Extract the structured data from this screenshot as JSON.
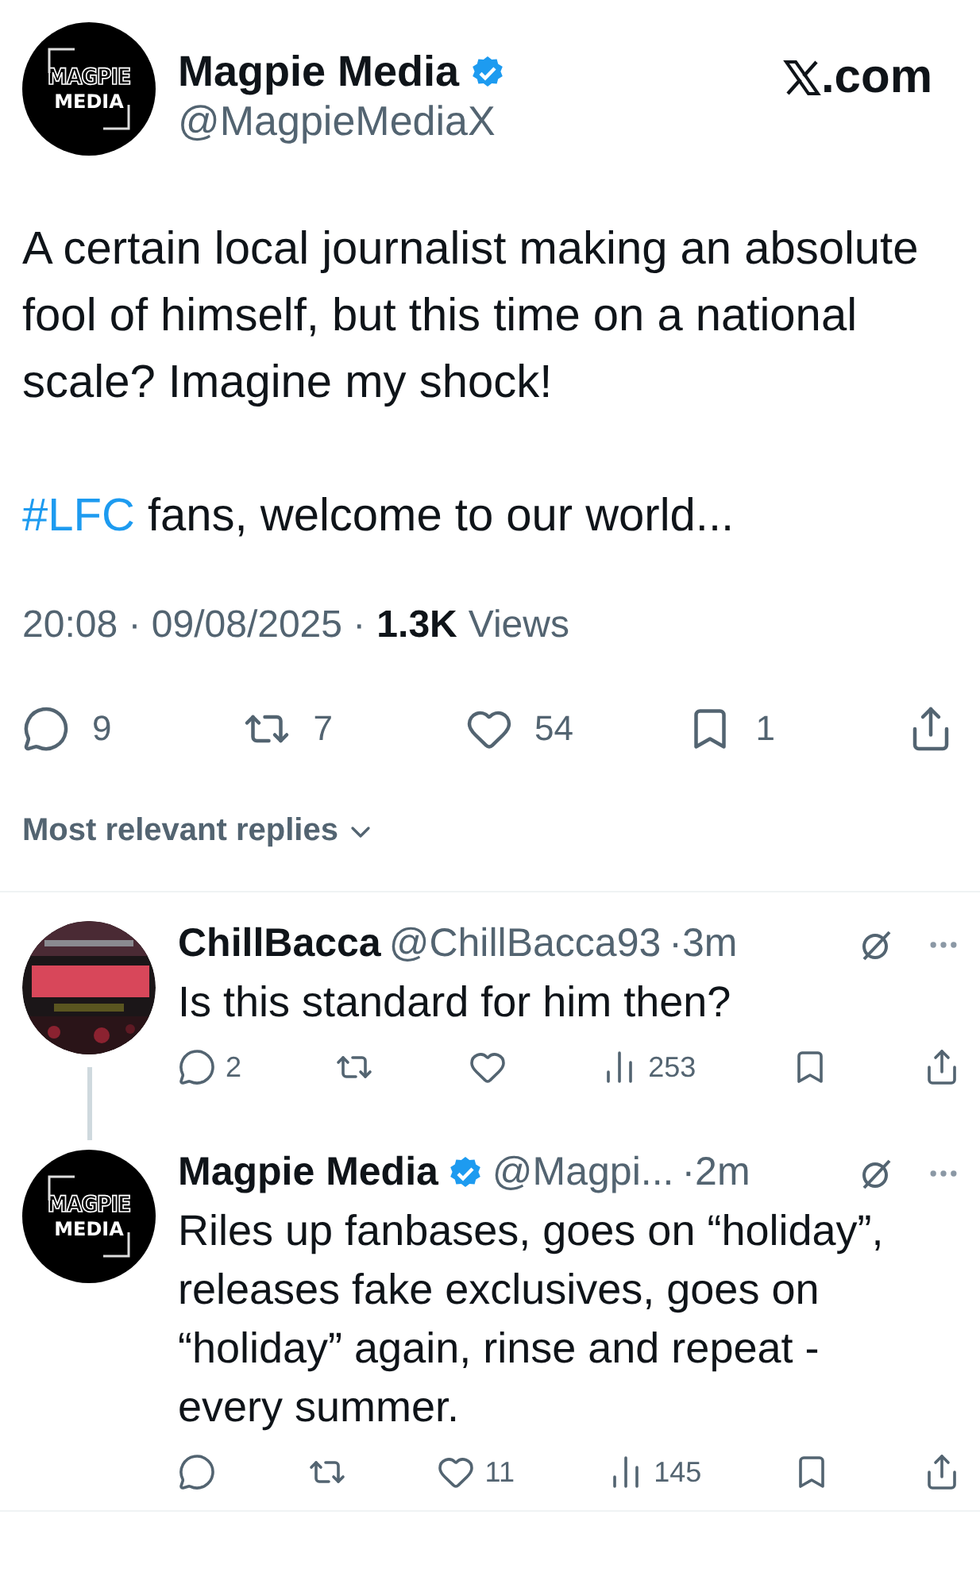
{
  "post": {
    "author": {
      "name": "Magpie Media",
      "handle": "@MagpieMediaX",
      "verified": true,
      "logo_top": "MAGPIE",
      "logo_bottom": "MEDIA"
    },
    "site": ".com",
    "paragraphs": [
      {
        "segments": [
          {
            "kind": "text",
            "text": "A certain local journalist making an absolute fool of himself, but this time on a national scale? Imagine my shock!"
          }
        ]
      },
      {
        "segments": [
          {
            "kind": "hashtag",
            "text": "#LFC"
          },
          {
            "kind": "text",
            "text": " fans, welcome to our world..."
          }
        ]
      }
    ],
    "timestamp": "20:08 · 09/08/2025 ·",
    "views_count": "1.3K",
    "views_label": "Views",
    "actions": [
      {
        "kind": "reply",
        "count": "9"
      },
      {
        "kind": "repost",
        "count": "7"
      },
      {
        "kind": "like",
        "count": "54"
      },
      {
        "kind": "bookmark",
        "count": "1"
      },
      {
        "kind": "share"
      }
    ]
  },
  "sort": {
    "label": "Most relevant replies"
  },
  "replies": [
    {
      "avatar": {
        "kind": "picture"
      },
      "name": "ChillBacca",
      "verified": false,
      "handle": "@ChillBacca93",
      "time": "·3m",
      "thread_continues": true,
      "lines": [
        "Is this standard for him then?"
      ],
      "actions": [
        {
          "kind": "reply",
          "count": "2"
        },
        {
          "kind": "repost"
        },
        {
          "kind": "like"
        },
        {
          "kind": "views",
          "count": "253"
        },
        {
          "kind": "bookmark"
        },
        {
          "kind": "share"
        }
      ]
    },
    {
      "avatar": {
        "kind": "logo",
        "logo_top": "MAGPIE",
        "logo_bottom": "MEDIA"
      },
      "name": "Magpie Media",
      "verified": true,
      "handle": "@Magpi...",
      "time": "·2m",
      "thread_continues": false,
      "lines": [
        "Riles up fanbases, goes on “holiday”,",
        "releases fake exclusives, goes on",
        "“holiday” again, rinse and repeat -",
        "every summer."
      ],
      "actions": [
        {
          "kind": "reply"
        },
        {
          "kind": "repost"
        },
        {
          "kind": "like",
          "count": "11"
        },
        {
          "kind": "views",
          "count": "145"
        },
        {
          "kind": "bookmark"
        },
        {
          "kind": "share"
        }
      ]
    }
  ]
}
